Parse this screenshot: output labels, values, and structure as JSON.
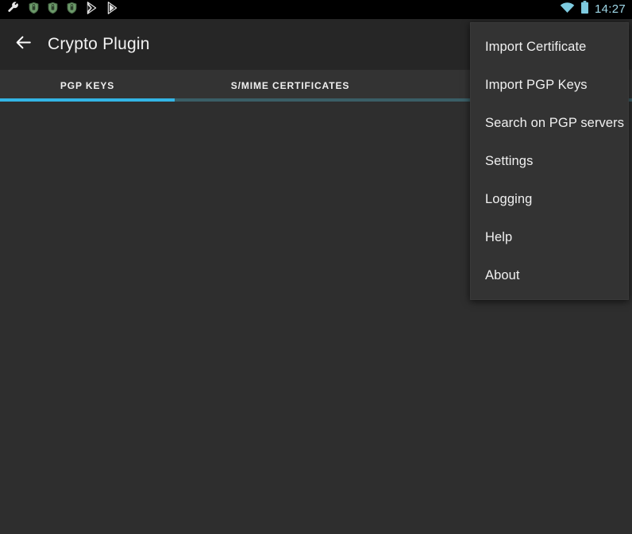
{
  "statusbar": {
    "left_icons": [
      {
        "name": "wrench-icon",
        "glyph": "wrench"
      },
      {
        "name": "shield-icon-1",
        "glyph": "shield"
      },
      {
        "name": "shield-icon-2",
        "glyph": "shield"
      },
      {
        "name": "shield-icon-3",
        "glyph": "shield"
      },
      {
        "name": "play-store-icon-1",
        "glyph": "play-triangle"
      },
      {
        "name": "play-store-icon-2",
        "glyph": "play-triangle"
      }
    ],
    "wifi_icon": "wifi-icon",
    "battery_icon": "battery-full-icon",
    "clock": "14:27",
    "accent_color": "#9fd8e8",
    "background": "#000000"
  },
  "actionbar": {
    "back_icon": "back-arrow-icon",
    "title": "Crypto Plugin",
    "background": "#262626"
  },
  "tabs": {
    "items": [
      {
        "label": "PGP KEYS",
        "active": true
      },
      {
        "label": "S/MIME CERTIFICATES",
        "active": false
      }
    ],
    "indicator_color": "#33b5e5",
    "background": "#333333"
  },
  "content": {
    "background": "#2e2e2e",
    "empty": ""
  },
  "overflow_menu": {
    "visible": true,
    "background": "#333333",
    "items": [
      {
        "label": "Import Certificate"
      },
      {
        "label": "Import PGP Keys"
      },
      {
        "label": "Search on PGP servers"
      },
      {
        "label": "Settings"
      },
      {
        "label": "Logging"
      },
      {
        "label": "Help"
      },
      {
        "label": "About"
      }
    ]
  }
}
